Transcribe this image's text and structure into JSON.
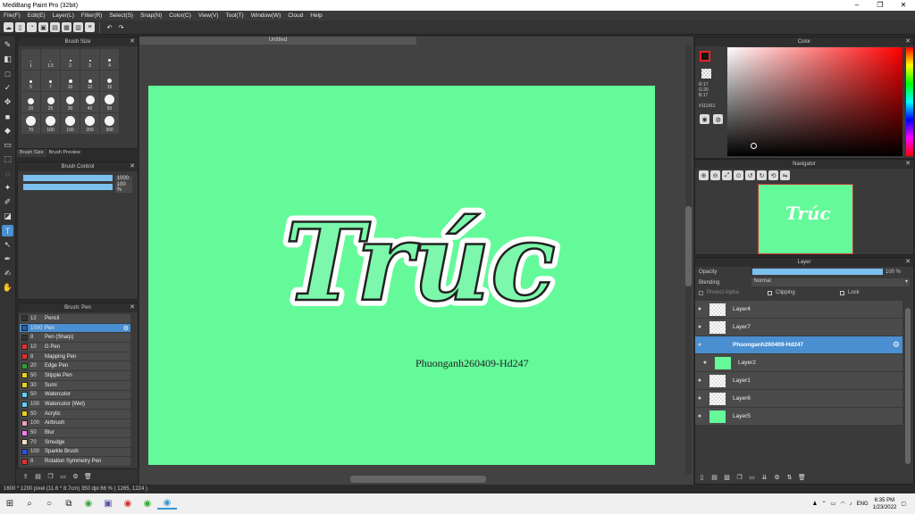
{
  "window": {
    "title": "MediBang Paint Pro (32bit)"
  },
  "menu": [
    "File(F)",
    "Edit(E)",
    "Layer(L)",
    "Filter(R)",
    "Select(S)",
    "Snap(N)",
    "Color(C)",
    "View(V)",
    "Tool(T)",
    "Window(W)",
    "Cloud",
    "Help"
  ],
  "brush_size": {
    "title": "Brush Size",
    "sizes": [
      "1",
      "1.5",
      "2",
      "3",
      "4",
      "5",
      "7",
      "10",
      "12",
      "15",
      "20",
      "25",
      "30",
      "40",
      "50",
      "70",
      "100",
      "150",
      "200",
      "300"
    ],
    "tabs": [
      "Brush Size",
      "Brush Preview"
    ]
  },
  "brush_control": {
    "title": "Brush Control",
    "size_value": "1000",
    "opacity_value": "100 %"
  },
  "brush_list": {
    "title": "Brush: Pen",
    "items": [
      {
        "num": "12",
        "name": "Pencil",
        "color": "#333333"
      },
      {
        "num": "1000",
        "name": "Pen",
        "color": "#2a5fa0"
      },
      {
        "num": "8",
        "name": "Pen (Sharp)",
        "color": "#333333"
      },
      {
        "num": "10",
        "name": "G Pen",
        "color": "#e03030"
      },
      {
        "num": "8",
        "name": "Mapping Pen",
        "color": "#e03030"
      },
      {
        "num": "20",
        "name": "Edge Pen",
        "color": "#30a030"
      },
      {
        "num": "50",
        "name": "Stipple Pen",
        "color": "#e8d020"
      },
      {
        "num": "30",
        "name": "Sumi",
        "color": "#e8d020"
      },
      {
        "num": "50",
        "name": "Watercolor",
        "color": "#60d0f0"
      },
      {
        "num": "100",
        "name": "Watercolor (Wet)",
        "color": "#60d0f0"
      },
      {
        "num": "50",
        "name": "Acrylic",
        "color": "#e8d020"
      },
      {
        "num": "100",
        "name": "Airbrush",
        "color": "#f0a0c0"
      },
      {
        "num": "50",
        "name": "Blur",
        "color": "#f080f0"
      },
      {
        "num": "70",
        "name": "Smudge",
        "color": "#f0e0c0"
      },
      {
        "num": "100",
        "name": "Sparkle Brush",
        "color": "#3050e0"
      },
      {
        "num": "8",
        "name": "Rotation Symmetry Pen",
        "color": "#e03030"
      }
    ]
  },
  "document": {
    "tab": "Untitled",
    "artwork_text": "Trúc",
    "signature": "Phuonganh260409-Hd247"
  },
  "status": "1600 * 1200 pixel   (11.6 * 8.7cm)   350 dpi   66 %   ( 1265, 1224 )",
  "color_panel": {
    "title": "Color",
    "r": "R:17",
    "g": "G:20",
    "b": "B:17",
    "hex": "#111411"
  },
  "navigator": {
    "title": "Navigator",
    "thumb_text": "Trúc"
  },
  "layer_panel": {
    "title": "Layer",
    "opacity_label": "Opacity",
    "opacity_value": "100 %",
    "blending_label": "Blending",
    "blending_value": "Normal",
    "protect_alpha": "Protect Alpha",
    "clipping": "Clipping",
    "lock": "Lock",
    "layers": [
      {
        "name": "Layer4"
      },
      {
        "name": "Layer7"
      },
      {
        "name": "Phuonganh260409-Hd247"
      },
      {
        "name": "Layer2"
      },
      {
        "name": "Layer1"
      },
      {
        "name": "Layer6"
      },
      {
        "name": "Layer5"
      }
    ]
  },
  "taskbar": {
    "lang": "ENG",
    "time": "6:35 PM",
    "date": "1/23/2022"
  },
  "colors": {
    "canvas": "#64fa9a",
    "accent": "#4a8fd0"
  }
}
